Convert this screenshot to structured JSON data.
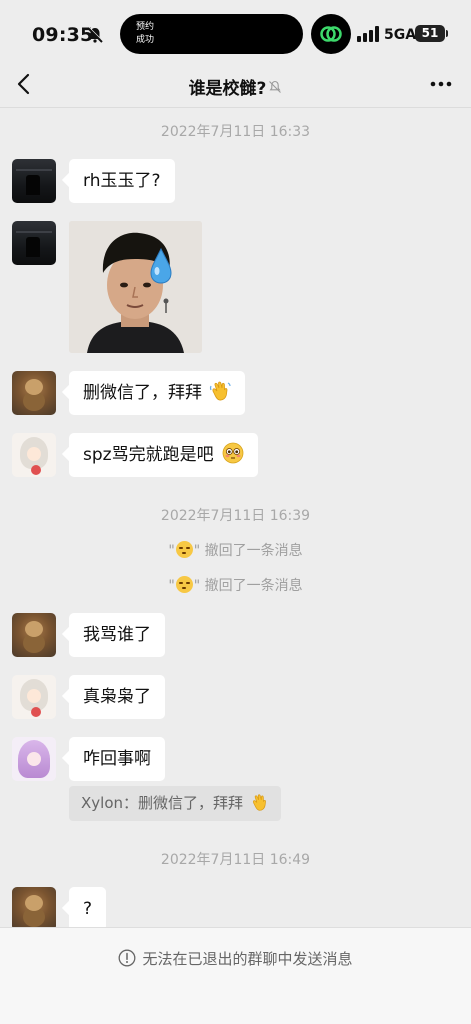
{
  "status_bar": {
    "time": "09:35",
    "island_line1": "预约",
    "island_line2": "成功",
    "network": "5GA",
    "battery": "51"
  },
  "nav": {
    "title": "谁是校雠?"
  },
  "messages": {
    "ts1": "2022年7月11日 16:33",
    "m1": "rh玉玉了?",
    "m3": "删微信了，拜拜",
    "m4": "spz骂完就跑是吧",
    "ts2": "2022年7月11日 16:39",
    "recall_prefix": "\"",
    "recall_suffix": "\" 撤回了一条消息",
    "m5": "我骂谁了",
    "m6": "真枭枭了",
    "m7": "咋回事啊",
    "quote": "Xylon：删微信了，拜拜",
    "ts3": "2022年7月11日 16:49",
    "m8": "?"
  },
  "footer": {
    "notice": "无法在已退出的群聊中发送消息"
  }
}
